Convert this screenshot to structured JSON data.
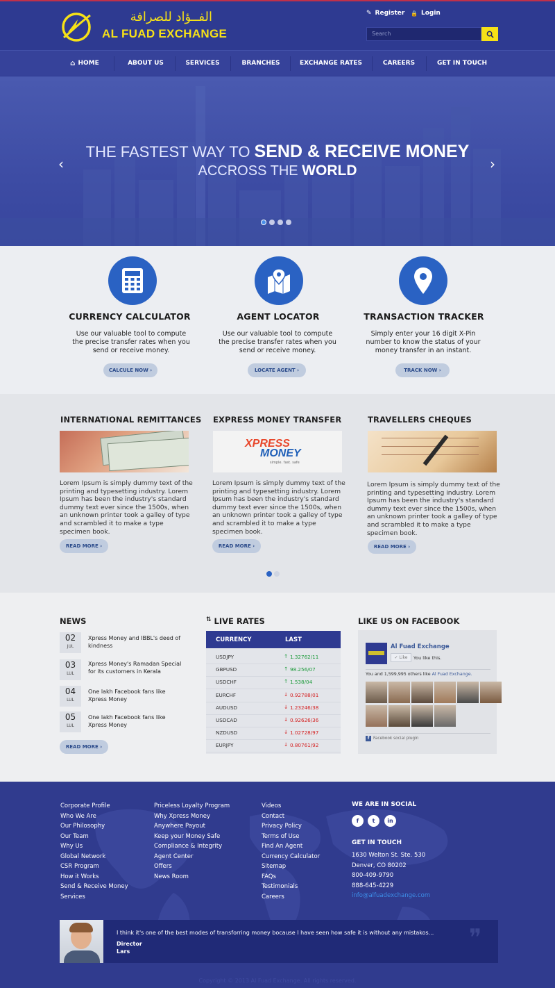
{
  "header": {
    "logo_arabic": "الفــؤاد للصرافة",
    "logo_name": "AL FUAD EXCHANGE",
    "register": "Register",
    "login": "Login",
    "search_placeholder": "Search"
  },
  "nav": [
    "HOME",
    "ABOUT US",
    "SERVICES",
    "BRANCHES",
    "EXCHANGE RATES",
    "CAREERS",
    "GET IN TOUCH"
  ],
  "hero": {
    "line1_prefix": "THE FASTEST WAY TO ",
    "line1_bold": "SEND & RECEIVE MONEY",
    "line2_prefix": "ACCROSS THE ",
    "line2_bold": "WORLD"
  },
  "features": [
    {
      "icon": "calculator-icon",
      "title": "CURRENCY CALCULATOR",
      "desc": "Use our valuable tool to compute the precise transfer rates when you send or receive money.",
      "button": "CALCULE NOW"
    },
    {
      "icon": "map-pin-icon",
      "title": "AGENT LOCATOR",
      "desc": "Use our valuable tool to compute the precise transfer rates when you send or receive money.",
      "button": "LOCATE AGENT"
    },
    {
      "icon": "location-pin-icon",
      "title": "TRANSACTION TRACKER",
      "desc": "Simply enter your 16 digit X-Pin number to know the status of your money transfer in an instant.",
      "button": "TRACK NOW"
    }
  ],
  "services": [
    {
      "title": "INTERNATIONAL REMITTANCES",
      "desc": "Lorem Ipsum is simply dummy text of the printing and typesetting industry. Lorem Ipsum has been the industry's standard dummy text ever since the 1500s, when an unknown printer took a galley of type and scrambled it to make a type specimen book.",
      "button": "READ MORE"
    },
    {
      "title": "EXPRESS MONEY TRANSFER",
      "desc": "Lorem Ipsum is simply dummy text of the printing and typesetting industry. Lorem Ipsum has been the industry's standard dummy text ever since the 1500s, when an unknown printer took a galley of type and scrambled it to make a type specimen book.",
      "button": "READ MORE",
      "logo_top": "XPRESS",
      "logo_bottom": "MONEY",
      "logo_tagline": "simple. fast. safe"
    },
    {
      "title": "TRAVELLERS CHEQUES",
      "desc": "Lorem Ipsum is simply dummy text of the printing and typesetting industry. Lorem Ipsum has been the industry's standard dummy text ever since the 1500s, when an unknown printer took a galley of type and scrambled it to make a type specimen book.",
      "button": "READ MORE"
    }
  ],
  "news": {
    "title": "NEWS",
    "items": [
      {
        "day": "02",
        "month": "JUL",
        "text": "Xpress Money and IBBL's deed of kindness"
      },
      {
        "day": "03",
        "month": "LUL",
        "text": "Xpress Money's Ramadan Special for its customers in Kerala"
      },
      {
        "day": "04",
        "month": "LUL",
        "text": "One lakh Facebook fans like Xpress Money"
      },
      {
        "day": "05",
        "month": "LUL",
        "text": "One lakh Facebook fans like Xpress Money"
      }
    ],
    "button": "READ MORE"
  },
  "live_rates": {
    "title": "LIVE RATES",
    "col_currency": "CURRENCY",
    "col_last": "LAST",
    "rows": [
      {
        "pair": "USDJPY",
        "value": "1.32762/11",
        "dir": "up"
      },
      {
        "pair": "GBPUSD",
        "value": "98.256/07",
        "dir": "up"
      },
      {
        "pair": "USDCHF",
        "value": "1.538/04",
        "dir": "up"
      },
      {
        "pair": "EURCHF",
        "value": "0.92788/01",
        "dir": "down"
      },
      {
        "pair": "AUDUSD",
        "value": "1.23246/38",
        "dir": "down"
      },
      {
        "pair": "USDCAD",
        "value": "0.92626/36",
        "dir": "down"
      },
      {
        "pair": "NZDUSD",
        "value": "1.02728/97",
        "dir": "down"
      },
      {
        "pair": "EURJPY",
        "value": "0.80761/92",
        "dir": "down"
      }
    ],
    "up_color": "#1c9a3a",
    "down_color": "#d42020"
  },
  "facebook": {
    "title": "LIKE US ON FACEBOOK",
    "page_name": "Al Fuad Exchange",
    "like_button": "Like",
    "you_like": "You like this.",
    "count_text": "You and 1,599,995 others like ",
    "count_link": "Al Fuad Exchange.",
    "plugin": "Facebook social plugin"
  },
  "footer": {
    "col1": [
      "Corporate Profile",
      "Who We Are",
      "Our Philosophy",
      "Our Team",
      "Why Us",
      "Global Network",
      "CSR Program",
      "How it Works",
      "Send & Receive Money",
      "Services"
    ],
    "col2": [
      "Priceless Loyalty Program",
      "Why Xpress Money",
      "Anywhere Payout",
      "Keep your Money Safe",
      "Compliance & Integrity",
      "Agent Center",
      "Offers",
      "News Room"
    ],
    "col3": [
      "Videos",
      "Contact",
      "Privacy Policy",
      "Terms of Use",
      "Find An Agent",
      "Currency Calculator",
      "Sitemap",
      "FAQs",
      "Testimonials",
      "Careers"
    ],
    "social_title": "WE ARE IN SOCIAL",
    "social": [
      "f",
      "t",
      "in"
    ],
    "touch_title": "GET IN TOUCH",
    "address1": "1630 Welton St. Ste. 530",
    "address2": "Denver, CO 80202",
    "phone1": "800-409-9790",
    "phone2": "888-645-4229",
    "email": "info@alfuadexchange.com",
    "testimonial_quote": "I think it's one of the best modes of transforring money bocause I have seen how safe it is without any mistakos...",
    "testimonial_role": "Director",
    "testimonial_name": "Lars",
    "copyright": "Copyright © 2013 Al Fuad Exchange. All rights reserved."
  },
  "colors": {
    "primary": "#2e3a91",
    "accent": "#f6e117",
    "icon_blue": "#2a62c3"
  }
}
